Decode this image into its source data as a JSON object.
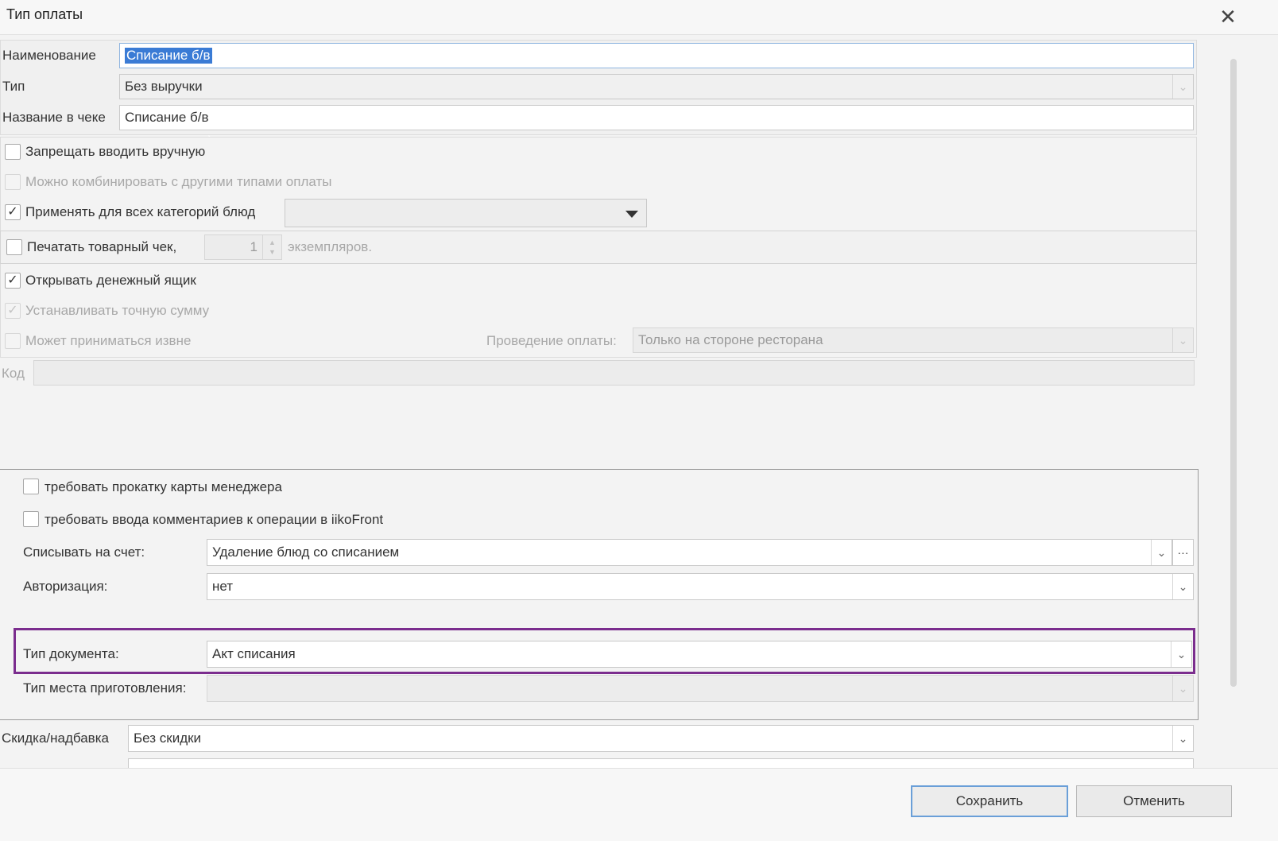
{
  "window": {
    "title": "Тип оплаты"
  },
  "fields": {
    "name": {
      "label": "Наименование",
      "value": "Списание б/в"
    },
    "type": {
      "label": "Тип",
      "value": "Без выручки"
    },
    "receipt_name": {
      "label": "Название в чеке",
      "value": "Списание б/в"
    }
  },
  "options": {
    "forbid_manual": {
      "label": "Запрещать вводить вручную",
      "checked": false
    },
    "combine": {
      "label": "Можно комбинировать с другими типами оплаты",
      "checked": false
    },
    "all_categories": {
      "label": "Применять для всех категорий блюд",
      "checked": true,
      "select_value": ""
    },
    "print_receipt": {
      "label": "Печатать товарный чек,",
      "copies": "1",
      "suffix": "экземпляров.",
      "checked": false
    },
    "open_drawer": {
      "label": "Открывать денежный ящик",
      "checked": true
    },
    "exact_sum": {
      "label": "Устанавливать точную сумму",
      "checked": true
    },
    "external": {
      "label": "Может приниматься извне",
      "checked": false
    },
    "processing": {
      "label": "Проведение оплаты:",
      "value": "Только на стороне ресторана"
    }
  },
  "code": {
    "label": "Код",
    "value": ""
  },
  "group": {
    "manager_card": {
      "label": "требовать прокатку карты менеджера",
      "checked": false
    },
    "comments": {
      "label": "требовать ввода комментариев к операции в iikoFront",
      "checked": false
    },
    "account": {
      "label": "Списывать на счет:",
      "value": "Удаление блюд со списанием",
      "more": "···"
    },
    "auth": {
      "label": "Авторизация:",
      "value": "нет"
    },
    "doc_type": {
      "label": "Тип документа:",
      "value": "Акт списания"
    },
    "place_type": {
      "label": "Тип места приготовления:",
      "value": ""
    }
  },
  "discount": {
    "label": "Скидка/надбавка",
    "value": "Без скидки"
  },
  "buttons": {
    "save": "Сохранить",
    "cancel": "Отменить"
  },
  "colors": {
    "highlight": "#7b2d8e",
    "selection": "#3a7bd5"
  },
  "icons": {
    "close": "close-icon",
    "dropdown": "chevron-down-icon",
    "check": "check-icon"
  }
}
